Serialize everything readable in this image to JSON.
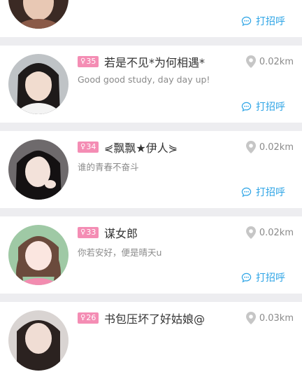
{
  "colors": {
    "accent_blue": "#2fa5e6",
    "badge_pink": "#f48db4",
    "page_bg": "#ededf0"
  },
  "icons": {
    "distance": "location-pin-icon",
    "greet": "chat-bubble-icon",
    "age": "female-symbol-icon"
  },
  "users": [
    {
      "age": "",
      "nickname": "",
      "signature": "",
      "distance": "",
      "greet_label": "打招呼"
    },
    {
      "age": "35",
      "nickname": "若是不见*为何相遇*",
      "signature": "Good good study, day day up!",
      "distance": "0.02km",
      "greet_label": "打招呼"
    },
    {
      "age": "34",
      "nickname": "⋞飘飘★伊人⋟",
      "signature": "谁的青春不奋斗",
      "distance": "0.02km",
      "greet_label": "打招呼"
    },
    {
      "age": "33",
      "nickname": "谋女郎",
      "signature": "你若安好，便是晴天u",
      "distance": "0.02km",
      "greet_label": "打招呼"
    },
    {
      "age": "26",
      "nickname": "书包压坏了好姑娘@",
      "signature": "",
      "distance": "0.03km",
      "greet_label": "打招呼"
    }
  ]
}
